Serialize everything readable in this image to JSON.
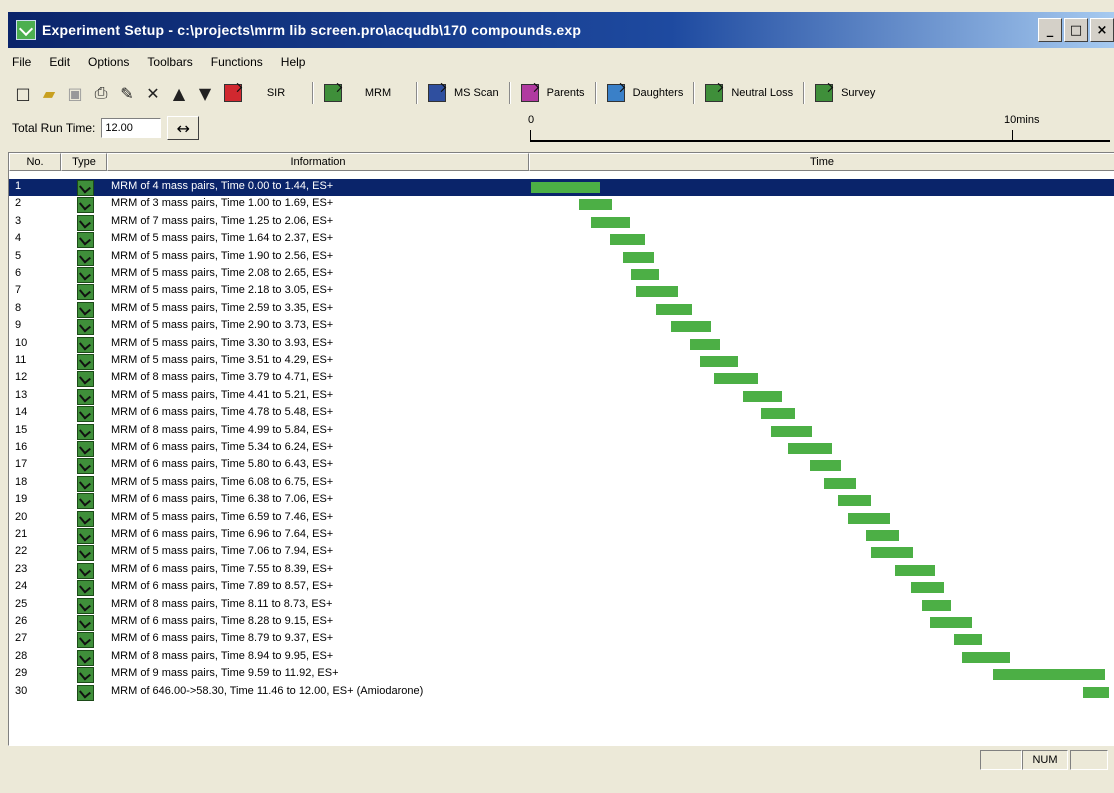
{
  "window": {
    "title": "Experiment Setup - c:\\projects\\mrm lib screen.pro\\acqudb\\170 compounds.exp",
    "controls": [
      "_",
      "□",
      "×"
    ]
  },
  "menu": [
    "File",
    "Edit",
    "Options",
    "Toolbars",
    "Functions",
    "Help"
  ],
  "toolbar": {
    "icons": [
      "new-icon",
      "open-icon",
      "save-icon",
      "print-icon",
      "edit-icon",
      "delete-icon",
      "move-up-icon",
      "move-down-icon"
    ],
    "functions": [
      {
        "label": "SIR",
        "icon": "sir-function-icon",
        "color": "#d1282f"
      },
      {
        "label": "MRM",
        "icon": "mrm-function-icon",
        "color": "#3f8f3a"
      },
      {
        "label": "MS Scan",
        "icon": "ms-scan-function-icon",
        "color": "#2f4f9f"
      },
      {
        "label": "Parents",
        "icon": "parents-function-icon",
        "color": "#b03aa0"
      },
      {
        "label": "Daughters",
        "icon": "daughters-function-icon",
        "color": "#3a80c8"
      },
      {
        "label": "Neutral Loss",
        "icon": "neutral-loss-function-icon",
        "color": "#3f8f3a"
      },
      {
        "label": "Survey",
        "icon": "survey-function-icon",
        "color": "#3f8f3a"
      }
    ]
  },
  "run": {
    "label": "Total Run Time:",
    "value": "12.00",
    "ruler_start": "0",
    "ruler_end": "10mins",
    "max_time": 12.0
  },
  "columns": {
    "no": "No.",
    "type": "Type",
    "info": "Information",
    "time": "Time"
  },
  "rows": [
    {
      "no": "1",
      "info": "MRM of 4 mass pairs, Time 0.00 to 1.44, ES+",
      "start": 0.0,
      "end": 1.44,
      "selected": true
    },
    {
      "no": "2",
      "info": "MRM of 3 mass pairs, Time 1.00 to 1.69, ES+",
      "start": 1.0,
      "end": 1.69
    },
    {
      "no": "3",
      "info": "MRM of 7 mass pairs, Time 1.25 to 2.06, ES+",
      "start": 1.25,
      "end": 2.06
    },
    {
      "no": "4",
      "info": "MRM of 5 mass pairs, Time 1.64 to 2.37, ES+",
      "start": 1.64,
      "end": 2.37
    },
    {
      "no": "5",
      "info": "MRM of 5 mass pairs, Time 1.90 to 2.56, ES+",
      "start": 1.9,
      "end": 2.56
    },
    {
      "no": "6",
      "info": "MRM of 5 mass pairs, Time 2.08 to 2.65, ES+",
      "start": 2.08,
      "end": 2.65
    },
    {
      "no": "7",
      "info": "MRM of 5 mass pairs, Time 2.18 to 3.05, ES+",
      "start": 2.18,
      "end": 3.05
    },
    {
      "no": "8",
      "info": "MRM of 5 mass pairs, Time 2.59 to 3.35, ES+",
      "start": 2.59,
      "end": 3.35
    },
    {
      "no": "9",
      "info": "MRM of 5 mass pairs, Time 2.90 to 3.73, ES+",
      "start": 2.9,
      "end": 3.73
    },
    {
      "no": "10",
      "info": "MRM of 5 mass pairs, Time 3.30 to 3.93, ES+",
      "start": 3.3,
      "end": 3.93
    },
    {
      "no": "11",
      "info": "MRM of 5 mass pairs, Time 3.51 to 4.29, ES+",
      "start": 3.51,
      "end": 4.29
    },
    {
      "no": "12",
      "info": "MRM of 8 mass pairs, Time 3.79 to 4.71, ES+",
      "start": 3.79,
      "end": 4.71
    },
    {
      "no": "13",
      "info": "MRM of 5 mass pairs, Time 4.41 to 5.21, ES+",
      "start": 4.41,
      "end": 5.21
    },
    {
      "no": "14",
      "info": "MRM of 6 mass pairs, Time 4.78 to 5.48, ES+",
      "start": 4.78,
      "end": 5.48
    },
    {
      "no": "15",
      "info": "MRM of 8 mass pairs, Time 4.99 to 5.84, ES+",
      "start": 4.99,
      "end": 5.84
    },
    {
      "no": "16",
      "info": "MRM of 6 mass pairs, Time 5.34 to 6.24, ES+",
      "start": 5.34,
      "end": 6.24
    },
    {
      "no": "17",
      "info": "MRM of 6 mass pairs, Time 5.80 to 6.43, ES+",
      "start": 5.8,
      "end": 6.43
    },
    {
      "no": "18",
      "info": "MRM of 5 mass pairs, Time 6.08 to 6.75, ES+",
      "start": 6.08,
      "end": 6.75
    },
    {
      "no": "19",
      "info": "MRM of 6 mass pairs, Time 6.38 to 7.06, ES+",
      "start": 6.38,
      "end": 7.06
    },
    {
      "no": "20",
      "info": "MRM of 5 mass pairs, Time 6.59 to 7.46, ES+",
      "start": 6.59,
      "end": 7.46
    },
    {
      "no": "21",
      "info": "MRM of 6 mass pairs, Time 6.96 to 7.64, ES+",
      "start": 6.96,
      "end": 7.64
    },
    {
      "no": "22",
      "info": "MRM of 5 mass pairs, Time 7.06 to 7.94, ES+",
      "start": 7.06,
      "end": 7.94
    },
    {
      "no": "23",
      "info": "MRM of 6 mass pairs, Time 7.55 to 8.39, ES+",
      "start": 7.55,
      "end": 8.39
    },
    {
      "no": "24",
      "info": "MRM of 6 mass pairs, Time 7.89 to 8.57, ES+",
      "start": 7.89,
      "end": 8.57
    },
    {
      "no": "25",
      "info": "MRM of 8 mass pairs, Time 8.11 to 8.73, ES+",
      "start": 8.11,
      "end": 8.73
    },
    {
      "no": "26",
      "info": "MRM of 6 mass pairs, Time 8.28 to 9.15, ES+",
      "start": 8.28,
      "end": 9.15
    },
    {
      "no": "27",
      "info": "MRM of 6 mass pairs, Time 8.79 to 9.37, ES+",
      "start": 8.79,
      "end": 9.37
    },
    {
      "no": "28",
      "info": "MRM of 8 mass pairs, Time 8.94 to 9.95, ES+",
      "start": 8.94,
      "end": 9.95
    },
    {
      "no": "29",
      "info": "MRM of 9 mass pairs, Time 9.59 to 11.92, ES+",
      "start": 9.59,
      "end": 11.92
    },
    {
      "no": "30",
      "info": "MRM of 646.00->58.30, Time 11.46 to 12.00, ES+ (Amiodarone)",
      "start": 11.46,
      "end": 12.0
    }
  ],
  "status": {
    "num": "NUM"
  },
  "colors": {
    "bar": "#4caf45",
    "selection": "#0a246a",
    "title_start": "#0a246a",
    "title_end": "#a6caf0"
  }
}
